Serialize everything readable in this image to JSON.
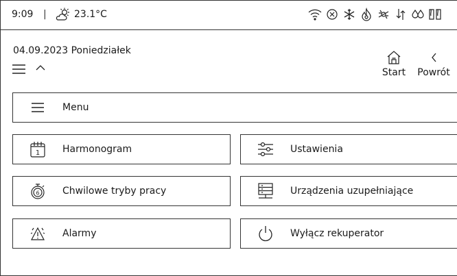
{
  "status": {
    "time": "9:09",
    "separator": "|",
    "temperature": "23.1°C",
    "icons": [
      "wifi-icon",
      "error-circle-icon",
      "snowflake-icon",
      "flame-icon",
      "bypass-icon",
      "airflow-icon",
      "humidity-icon",
      "filter-icon"
    ]
  },
  "header": {
    "date": "04.09.2023 Poniedziałek",
    "start_label": "Start",
    "back_label": "Powrót"
  },
  "menu": {
    "label": "Menu"
  },
  "tiles": {
    "schedule": {
      "label": "Harmonogram",
      "icon_digit": "1"
    },
    "settings": {
      "label": "Ustawienia"
    },
    "temp_modes": {
      "label": "Chwilowe tryby pracy"
    },
    "aux_devices": {
      "label": "Urządzenia uzupełniające"
    },
    "alarms": {
      "label": "Alarmy"
    },
    "power_off": {
      "label": "Wyłącz rekuperator"
    }
  }
}
